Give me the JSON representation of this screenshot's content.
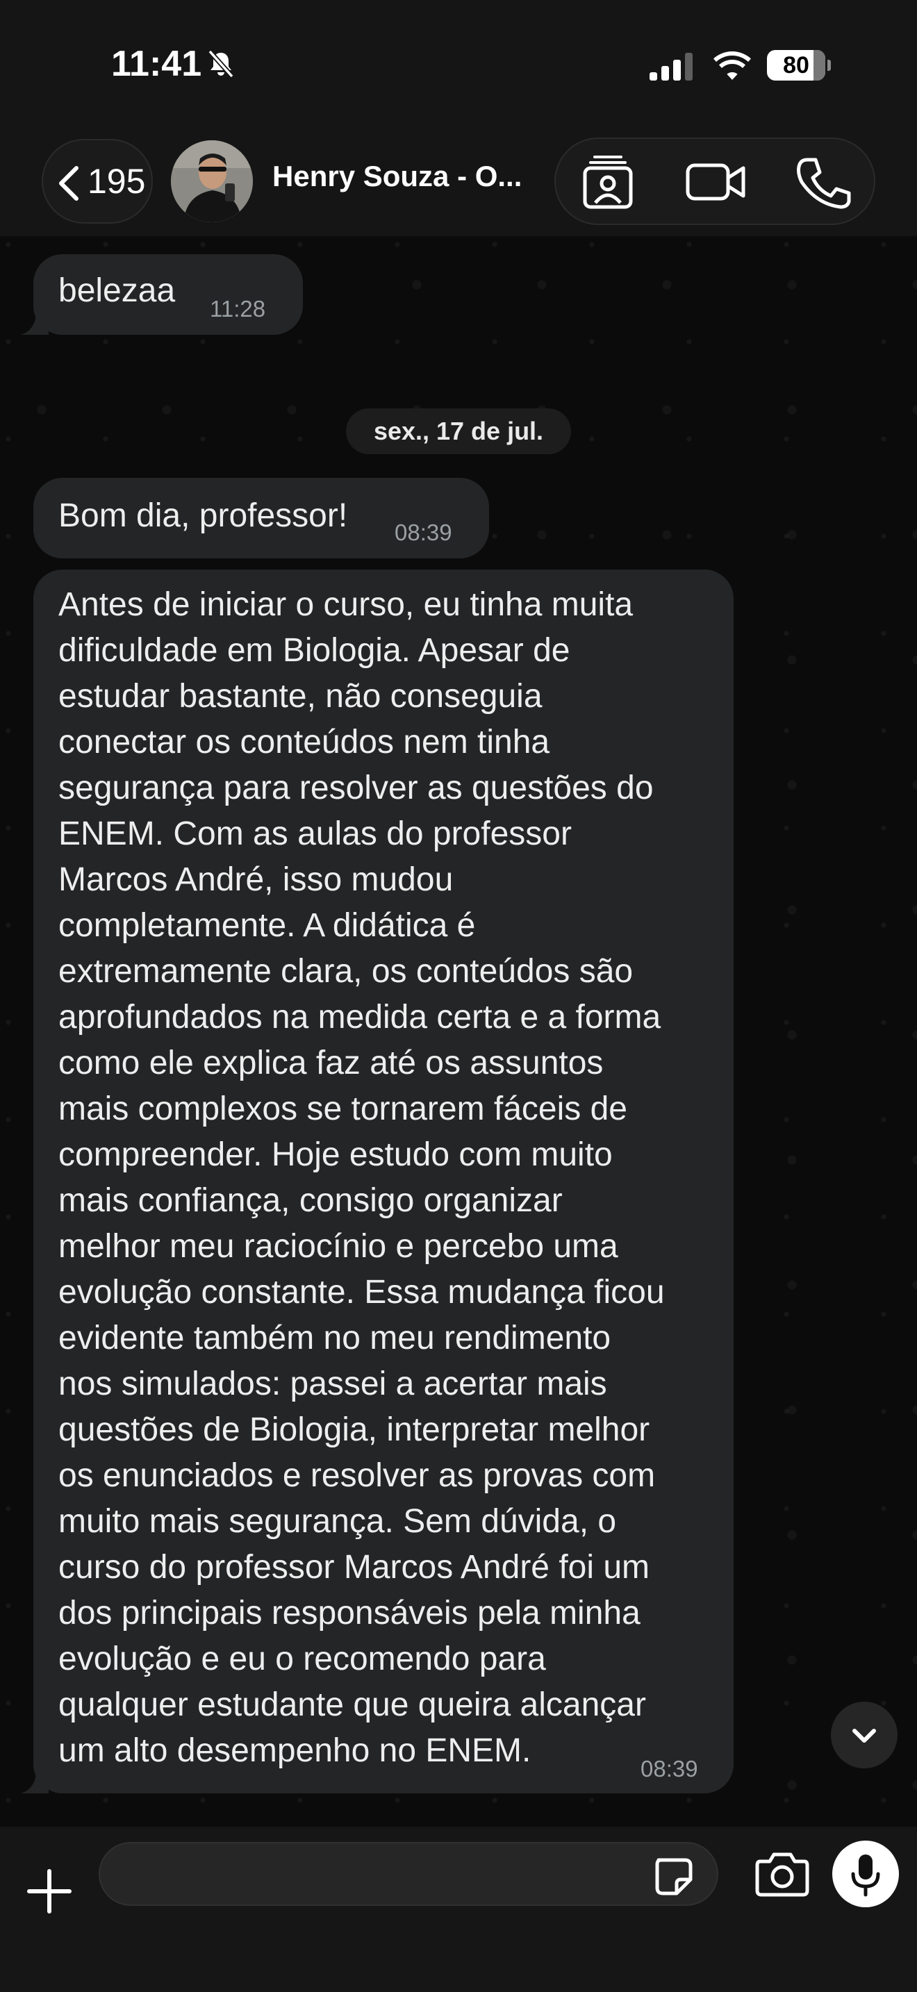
{
  "status_bar": {
    "time": "11:41",
    "battery_percent": 80,
    "battery_label": "80",
    "icons": [
      "bell-slash-icon",
      "cellular-signal-icon",
      "wifi-icon",
      "battery-icon"
    ]
  },
  "header": {
    "back_count": "195",
    "contact_name": "Henry Souza - O...",
    "actions": [
      "contact-card-icon",
      "video-call-icon",
      "phone-call-icon"
    ]
  },
  "messages": [
    {
      "text": "belezaa",
      "time": "11:28",
      "direction": "incoming"
    },
    {
      "text": "Bom dia, professor!",
      "time": "08:39",
      "direction": "incoming"
    },
    {
      "text": "Antes de iniciar o curso, eu tinha muita dificuldade em Biologia. Apesar de estudar bastante, não conseguia conectar os conteúdos nem tinha segurança para resolver as questões do ENEM. Com as aulas do professor Marcos André, isso mudou completamente. A didática é extremamente clara, os conteúdos são aprofundados na medida certa e a forma como ele explica faz até os assuntos mais complexos se tornarem fáceis de compreender. Hoje estudo com muito mais confiança, consigo organizar melhor meu raciocínio e percebo uma evolução constante. Essa mudança ficou evidente também no meu rendimento nos simulados: passei a acertar mais questões de Biologia, interpretar melhor os enunciados e resolver as provas com muito mais segurança. Sem dúvida, o curso do professor Marcos André foi um dos principais responsáveis pela minha evolução e eu o recomendo para qualquer estudante que queira alcançar um alto desempenho no ENEM.",
      "time": "08:39",
      "direction": "incoming"
    }
  ],
  "date_separator": "sex., 17 de jul.",
  "long_message_lines": [
    "Antes de iniciar o curso, eu tinha muita",
    "dificuldade em Biologia. Apesar de",
    "estudar bastante, não conseguia",
    "conectar os conteúdos nem tinha",
    "segurança para resolver as questões do",
    "ENEM. Com as aulas do professor",
    "Marcos André, isso mudou",
    "completamente. A didática é",
    "extremamente clara, os conteúdos são",
    "aprofundados na medida certa e a forma",
    "como ele explica faz até os assuntos",
    "mais complexos se tornarem fáceis de",
    "compreender. Hoje estudo com muito",
    "mais confiança, consigo organizar",
    "melhor meu raciocínio e percebo uma",
    "evolução constante. Essa mudança ficou",
    "evidente também no meu rendimento",
    "nos simulados: passei a acertar mais",
    "questões de Biologia, interpretar melhor",
    "os enunciados e resolver as provas com",
    "muito mais segurança. Sem dúvida, o",
    "curso do professor Marcos André foi um",
    "dos principais responsáveis pela minha",
    "evolução e eu o recomendo para",
    "qualquer estudante que queira alcançar",
    "um alto desempenho no ENEM."
  ],
  "input_bar": {
    "message_value": "",
    "icons": [
      "plus-icon",
      "sticker-icon",
      "camera-icon",
      "microphone-icon"
    ]
  },
  "colors": {
    "background": "#0b0b0b",
    "bubble_incoming": "#242526",
    "header": "#151515",
    "timestamp": "#9aa0a3"
  }
}
